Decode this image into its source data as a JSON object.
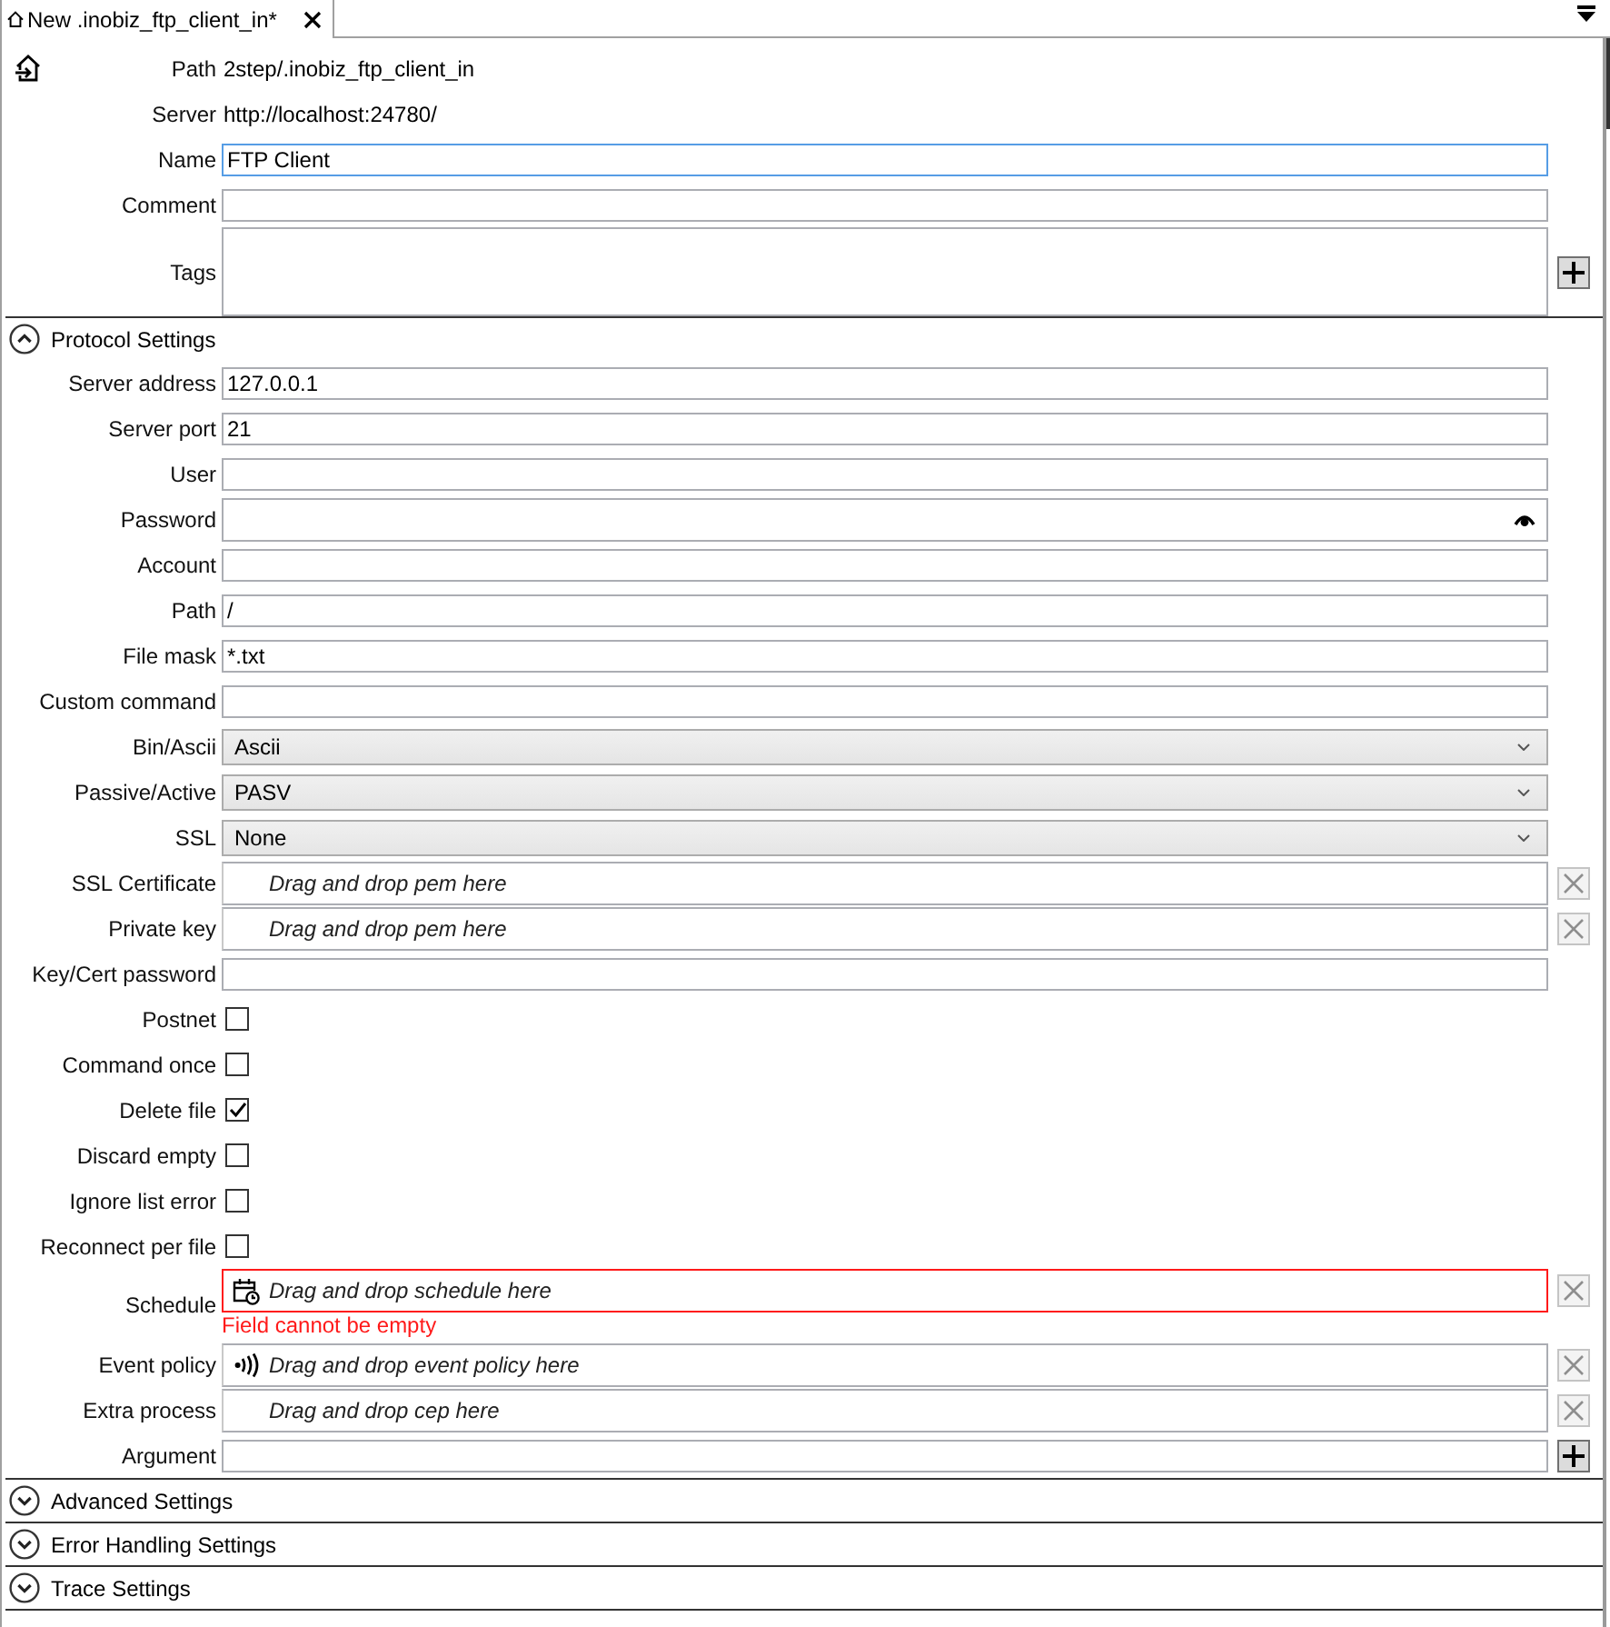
{
  "tab": {
    "title": "New .inobiz_ftp_client_in*",
    "selected": true
  },
  "info": [
    {
      "label": "Path",
      "value": "2step/.inobiz_ftp_client_in"
    },
    {
      "label": "Server",
      "value": "http://localhost:24780/"
    }
  ],
  "fields": [
    {
      "kind": "text",
      "label": "Name",
      "value": "FTP Client",
      "focused": true
    },
    {
      "kind": "text",
      "label": "Comment",
      "focused": false
    },
    {
      "kind": "tags",
      "label": "Tags",
      "add": {
        "disabled": false
      }
    }
  ],
  "sections": [
    {
      "title": "Protocol Settings",
      "expanded": true,
      "rows": [
        {
          "kind": "text",
          "label": "Server address",
          "value": "127.0.0.1"
        },
        {
          "kind": "text",
          "label": "Server port",
          "value": "21"
        },
        {
          "kind": "text",
          "label": "User"
        },
        {
          "kind": "password",
          "label": "Password"
        },
        {
          "kind": "text",
          "label": "Account"
        },
        {
          "kind": "text",
          "label": "Path",
          "value": "/"
        },
        {
          "kind": "text",
          "label": "File mask",
          "value": "*.txt"
        },
        {
          "kind": "text",
          "label": "Custom command"
        },
        {
          "kind": "combo",
          "label": "Bin/Ascii",
          "value": "Ascii"
        },
        {
          "kind": "combo",
          "label": "Passive/Active",
          "value": "PASV"
        },
        {
          "kind": "combo",
          "label": "SSL",
          "value": "None"
        },
        {
          "kind": "drop",
          "label": "SSL Certificate",
          "placeholder": "Drag and drop pem here",
          "clear": {
            "disabled": true
          }
        },
        {
          "kind": "drop",
          "label": "Private key",
          "placeholder": "Drag and drop pem here",
          "clear": {
            "disabled": true
          }
        },
        {
          "kind": "text",
          "label": "Key/Cert password"
        },
        {
          "kind": "checkbox",
          "label": "Postnet",
          "checked": false
        },
        {
          "kind": "checkbox",
          "label": "Command once",
          "checked": false
        },
        {
          "kind": "checkbox",
          "label": "Delete file",
          "checked": true
        },
        {
          "kind": "checkbox",
          "label": "Discard empty",
          "checked": false
        },
        {
          "kind": "checkbox",
          "label": "Ignore list error",
          "checked": false
        },
        {
          "kind": "checkbox",
          "label": "Reconnect per file",
          "checked": false
        },
        {
          "kind": "schedule",
          "label": "Schedule",
          "placeholder": "Drag and drop schedule here",
          "error": "Field cannot be empty",
          "clear": {
            "disabled": true
          }
        },
        {
          "kind": "policy",
          "label": "Event policy",
          "placeholder": "Drag and drop event policy here",
          "clear": {
            "disabled": true
          }
        },
        {
          "kind": "drop",
          "label": "Extra process",
          "placeholder": "Drag and drop cep here",
          "clear": {
            "disabled": true
          }
        },
        {
          "kind": "list",
          "label": "Argument",
          "add": {
            "disabled": false
          }
        }
      ]
    },
    {
      "title": "Advanced Settings",
      "expanded": false
    },
    {
      "title": "Error Handling Settings",
      "expanded": false
    },
    {
      "title": "Trace Settings",
      "expanded": false
    }
  ]
}
